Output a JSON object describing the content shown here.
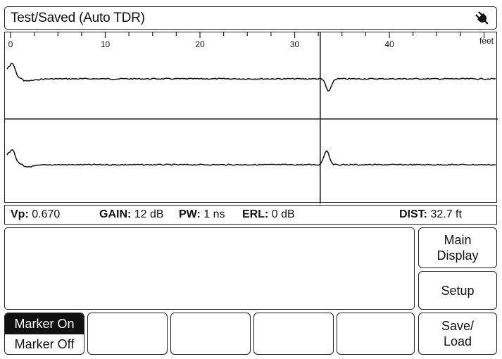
{
  "title_bar": {
    "title": "Test/Saved (Auto TDR)",
    "status_icon": "plug-icon"
  },
  "waveform": {
    "scale": {
      "ticks": [
        "0",
        "10",
        "20",
        "30",
        "40"
      ],
      "unit": "feet"
    },
    "cursor": {
      "value": 32.7,
      "unit": "ft"
    }
  },
  "status": {
    "vp_label": "Vp:",
    "vp_value": "0.670",
    "gain_label": "GAIN:",
    "gain_value": "12 dB",
    "pw_label": "PW:",
    "pw_value": "1 ns",
    "erl_label": "ERL:",
    "erl_value": "0 dB",
    "dist_label": "DIST:",
    "dist_value": "32.7 ft"
  },
  "message_area": {
    "text": ""
  },
  "side_buttons": {
    "main_display": "Main\nDisplay",
    "setup": "Setup",
    "save_load": "Save/\nLoad"
  },
  "softkeys": {
    "marker_on": "Marker On",
    "marker_off": "Marker Off",
    "selected": "marker_on"
  }
}
